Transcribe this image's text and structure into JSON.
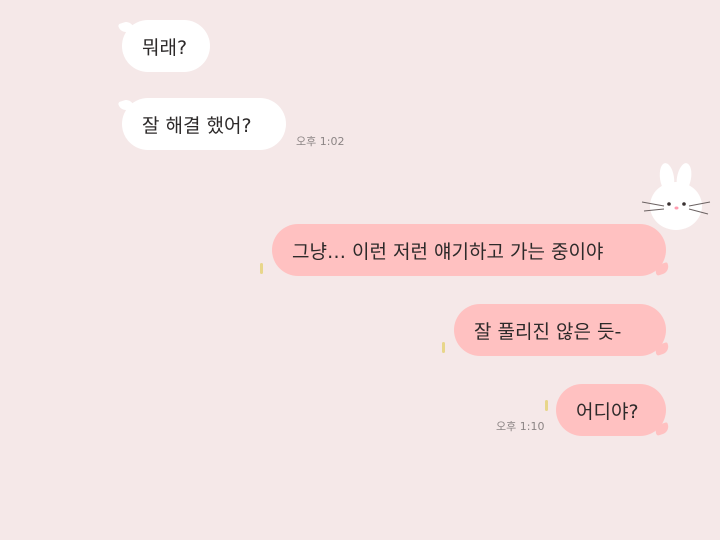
{
  "messages": {
    "m1": {
      "text": "뭐래?"
    },
    "m2": {
      "text": "잘 해결 했어?",
      "time": "오후 1:02"
    },
    "m3": {
      "text": "그냥… 이런 저런 얘기하고 가는 중이야"
    },
    "m4": {
      "text": "잘 풀리진 않은 듯-"
    },
    "m5": {
      "text": "어디야?",
      "time": "오후 1:10"
    }
  },
  "colors": {
    "background": "#f5e8e8",
    "incoming_bubble": "#ffffff",
    "outgoing_bubble": "#ffc1c1",
    "read_marker": "#e8d68a"
  },
  "icons": {
    "sticker": "bunny-icon",
    "read_marker": "read-tick-icon"
  }
}
